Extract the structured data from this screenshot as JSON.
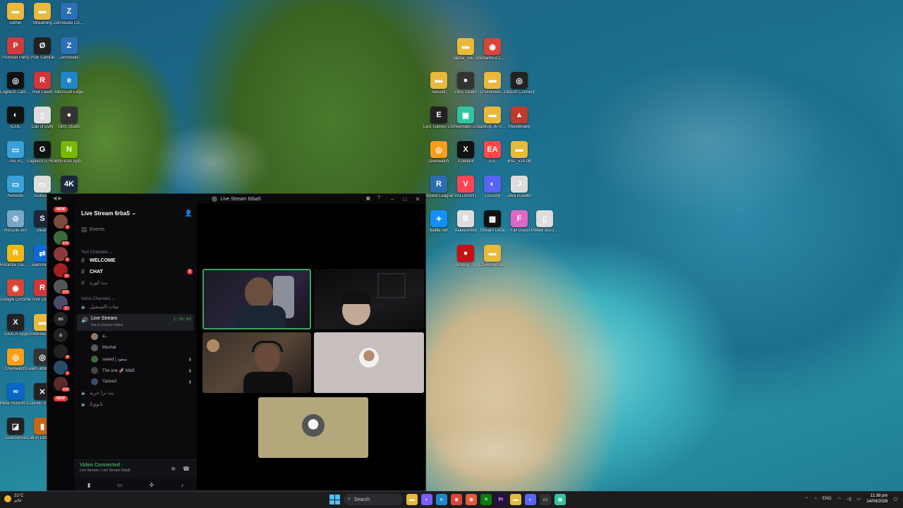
{
  "desktop": {
    "icons": [
      {
        "label": "Admin",
        "glyph": "▬",
        "color": "#e8b93a"
      },
      {
        "label": "Streaming",
        "glyph": "▬",
        "color": "#e8b93a"
      },
      {
        "label": "ZenStudio Config",
        "glyph": "Z",
        "color": "#2d6fb5"
      },
      {
        "label": "Pummel Party",
        "glyph": "P",
        "color": "#d03a3a"
      },
      {
        "label": "PDE Central",
        "glyph": "Ø",
        "color": "#222"
      },
      {
        "label": "ZenStudio",
        "glyph": "Z",
        "color": "#2d6fb5"
      },
      {
        "label": "Logitech Camera Hub",
        "glyph": "◎",
        "color": "#111"
      },
      {
        "label": "Riot Client",
        "glyph": "R",
        "color": "#d13639"
      },
      {
        "label": "Microsoft Edge",
        "glyph": "e",
        "color": "#1f86c9"
      },
      {
        "label": "iCUE",
        "glyph": "◐",
        "color": "#111"
      },
      {
        "label": "Call of Duty",
        "glyph": "▯",
        "color": "#ddd"
      },
      {
        "label": "OBS Studio",
        "glyph": "●",
        "color": "#333"
      },
      {
        "label": "This PC",
        "glyph": "▭",
        "color": "#3aa0d8"
      },
      {
        "label": "Logitech G HUB",
        "glyph": "G",
        "color": "#111"
      },
      {
        "label": "NVIDIA App",
        "glyph": "N",
        "color": "#76b900"
      },
      {
        "label": "Network",
        "glyph": "▭",
        "color": "#3aa0d8"
      },
      {
        "label": "restream",
        "glyph": "▭",
        "color": "#ddd"
      },
      {
        "label": "4K",
        "glyph": "4K",
        "color": "#1b2a3a"
      },
      {
        "label": "Recycle Bin",
        "glyph": "♲",
        "color": "#7aa7c7"
      },
      {
        "label": "Steam",
        "glyph": "S",
        "color": "#1b2838"
      },
      {
        "label": "Rockstar Games",
        "glyph": "R",
        "color": "#f3b712"
      },
      {
        "label": "TeamViewer",
        "glyph": "⇄",
        "color": "#0e6ad6"
      },
      {
        "label": "Google Chrome",
        "glyph": "◉",
        "color": "#db4437"
      },
      {
        "label": "Riot Client",
        "glyph": "R",
        "color": "#d13639"
      },
      {
        "label": "GeXLR App",
        "glyph": "X",
        "color": "#222"
      },
      {
        "label": "DS4Windows (2)",
        "glyph": "▬",
        "color": "#e8b93a"
      },
      {
        "label": "Overwatch",
        "glyph": "◎",
        "color": "#f99e1a"
      },
      {
        "label": "Learn about this picture",
        "glyph": "◎",
        "color": "#333"
      },
      {
        "label": "Meta Horizon Link",
        "glyph": "∞",
        "color": "#0a66c2"
      },
      {
        "label": "Counter-Strike 2",
        "glyph": "✕",
        "color": "#222"
      },
      {
        "label": "DualSense",
        "glyph": "◪",
        "color": "#222"
      },
      {
        "label": "Call of Duty Black Ops",
        "glyph": "▮",
        "color": "#c86414"
      },
      {
        "label": "alpha_sou...",
        "glyph": "▬",
        "color": "#e8b93a"
      },
      {
        "label": "MohaimEd Chrome",
        "glyph": "◉",
        "color": "#db4437"
      },
      {
        "label": "hidusbf",
        "glyph": "▬",
        "color": "#e8b93a"
      },
      {
        "label": "OBS Studio",
        "glyph": "●",
        "color": "#333"
      },
      {
        "label": "DS4Windo...",
        "glyph": "▬",
        "color": "#e8b93a"
      },
      {
        "label": "Ubisoft Connect",
        "glyph": "◎",
        "color": "#222"
      },
      {
        "label": "Epic Games Launcher",
        "glyph": "E",
        "color": "#222"
      },
      {
        "label": "Streamlabs Desktop",
        "glyph": "▣",
        "color": "#31c3a2"
      },
      {
        "label": "BackUp 30-05-2025",
        "glyph": "▬",
        "color": "#e8b93a"
      },
      {
        "label": "HandBrake",
        "glyph": "▲",
        "color": "#c0392b"
      },
      {
        "label": "Overwatch",
        "glyph": "◎",
        "color": "#f99e1a"
      },
      {
        "label": "XDefiant",
        "glyph": "X",
        "color": "#111"
      },
      {
        "label": "EA",
        "glyph": "EA",
        "color": "#ff4747"
      },
      {
        "label": "BSL_v14.08",
        "glyph": "▬",
        "color": "#e8b93a"
      },
      {
        "label": "Rocket League",
        "glyph": "R",
        "color": "#2b6cb0"
      },
      {
        "label": "VALORANT",
        "glyph": "V",
        "color": "#fd4556"
      },
      {
        "label": "Discord",
        "glyph": "◐",
        "color": "#5865f2"
      },
      {
        "label": "Java installer",
        "glyph": "J",
        "color": "#ddd"
      },
      {
        "label": "Battle.net",
        "glyph": "✦",
        "color": "#148eff"
      },
      {
        "label": "BakkesMod",
        "glyph": "B",
        "color": "#ddd"
      },
      {
        "label": "Stream Deck",
        "glyph": "▦",
        "color": "#111"
      },
      {
        "label": "Fall Guys",
        "glyph": "F",
        "color": "#e267c4"
      },
      {
        "label": "Untitled document",
        "glyph": "▯",
        "color": "#ddd"
      },
      {
        "label": "Among Us",
        "glyph": "●",
        "color": "#c51111"
      },
      {
        "label": "DS4Windows",
        "glyph": "▬",
        "color": "#e8b93a"
      }
    ]
  },
  "window": {
    "title": "Live Stream 6rba5",
    "server_name": "Live Stream 6rba5",
    "events_label": "Events",
    "text_category": "Text Channels",
    "voice_category": "Voice Channels",
    "text_channels": [
      {
        "name": "WELCOME",
        "bold": true
      },
      {
        "name": "CHAT",
        "bold": true,
        "badge": "1"
      },
      {
        "name": "بث-كورة",
        "bold": false
      }
    ],
    "voice_channels_pre": [
      {
        "name": "شات-التسجيل"
      }
    ],
    "active_voice": {
      "name": "Live Stream",
      "status": "Set a channel status",
      "timer": "1:36:09"
    },
    "members": [
      {
        "name": "a...",
        "color": "#8e7a6a",
        "cam": false
      },
      {
        "name": "Meshal",
        "color": "#5a5a5a",
        "cam": false
      },
      {
        "name": "saeed | سعود",
        "color": "#3a6a3a",
        "cam": true
      },
      {
        "name": "The one 🚀 M&B",
        "color": "#444",
        "cam": true
      },
      {
        "name": "Yazeed",
        "color": "#3a4a6a",
        "cam": true
      }
    ],
    "voice_channels_post": [
      {
        "name": "بث ثرا خربه"
      },
      {
        "name": "ثانوي2"
      }
    ],
    "voice_bar": {
      "status": "Video Connected",
      "location": "Live Stream / Live Stream 6rba5"
    },
    "rail_badges": [
      "NEW",
      "2",
      "449",
      "1",
      "11",
      "209",
      "37",
      "as",
      "a",
      "4",
      "1",
      "118",
      "NEW"
    ],
    "stage_tiles": [
      {
        "name": "tile-streamer-1",
        "label": ""
      },
      {
        "name": "tile-streamer-2",
        "label": ""
      },
      {
        "name": "tile-streamer-3",
        "label": ""
      },
      {
        "name": "tile-avatar-1",
        "label": ""
      },
      {
        "name": "tile-avatar-2",
        "label": ""
      }
    ]
  },
  "taskbar": {
    "weather_temp": "21°C",
    "weather_desc": "غائم",
    "search_placeholder": "Search",
    "lang": "ENG",
    "time": "11:38 pm",
    "date": "14/04/2026"
  },
  "colors": {
    "accent_green": "#3ba55c",
    "badge_red": "#e23b3b",
    "active_tile_border": "#3ba55c"
  }
}
